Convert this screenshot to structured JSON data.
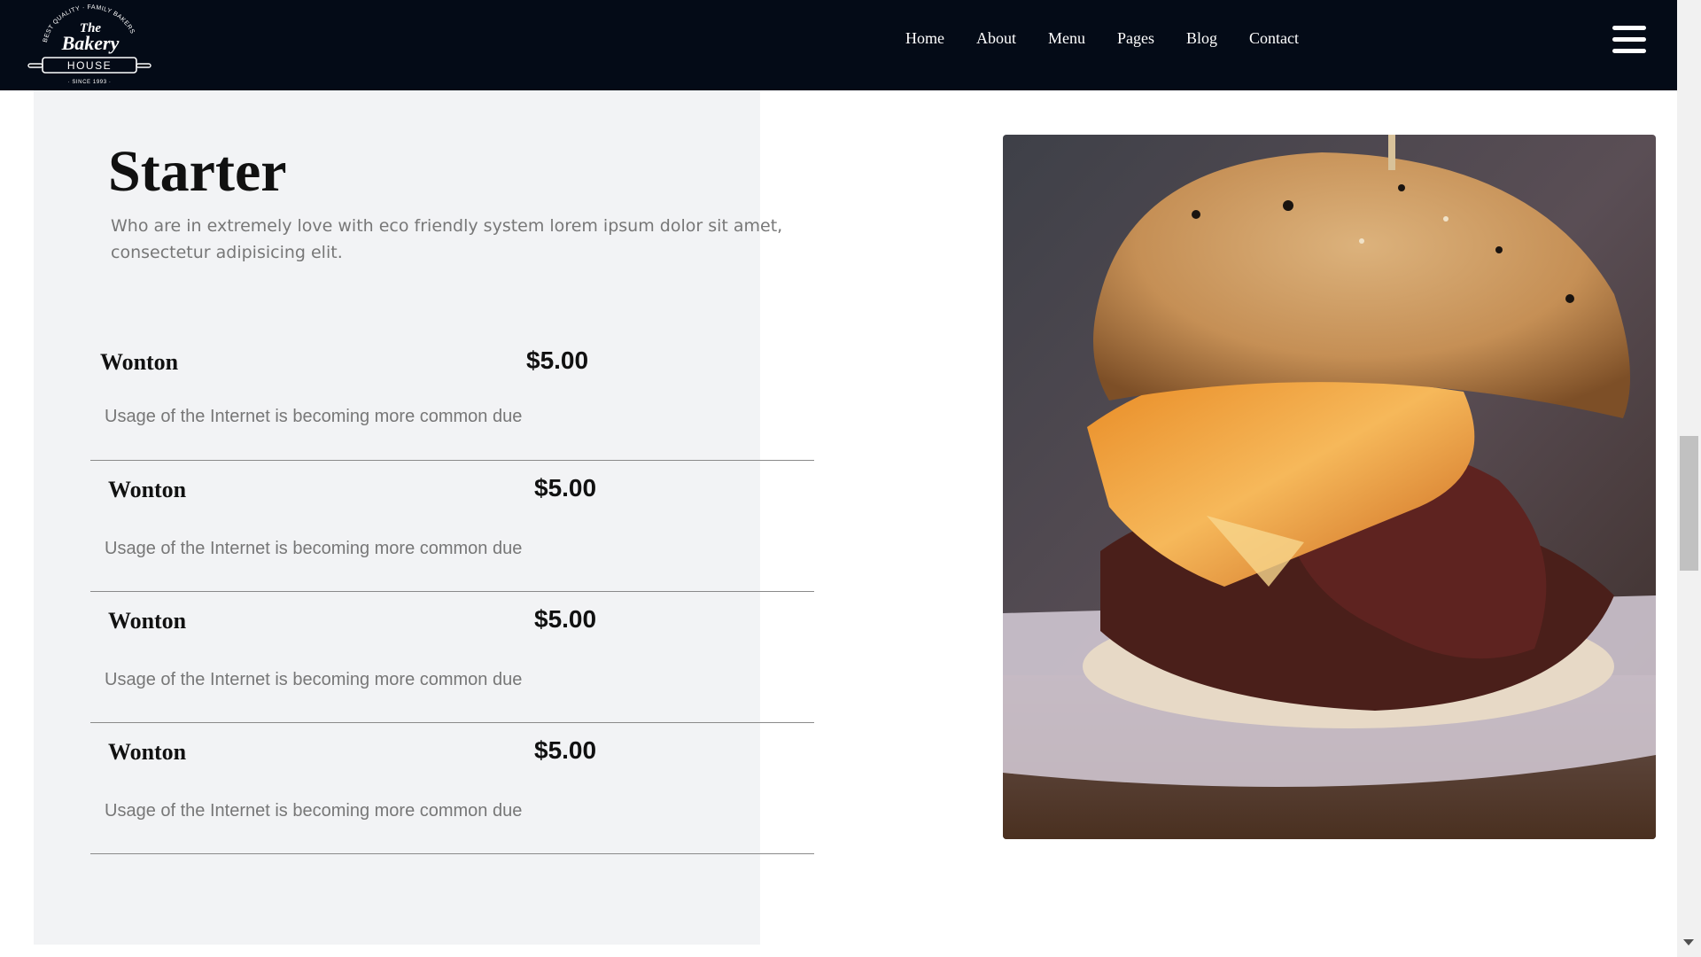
{
  "brand": {
    "logo_top": "BEST QUALITY · FAMILY BAKERS",
    "logo_the": "The",
    "logo_name": "Bakery",
    "logo_house": "HOUSE",
    "logo_since": "· SINCE 1993 ·"
  },
  "nav": {
    "items": [
      {
        "label": "Home"
      },
      {
        "label": "About"
      },
      {
        "label": "Menu"
      },
      {
        "label": "Pages"
      },
      {
        "label": "Blog"
      },
      {
        "label": "Contact"
      }
    ],
    "menu_icon": "hamburger-icon"
  },
  "section": {
    "title": "Starter",
    "description": "Who are in extremely love with eco friendly system lorem ipsum dolor sit amet, consectetur adipisicing elit."
  },
  "menu_items": [
    {
      "name": "Wonton",
      "price": "$5.00",
      "description": "Usage of the Internet is becoming more common due"
    },
    {
      "name": "Wonton",
      "price": "$5.00",
      "description": "Usage of the Internet is becoming more common due"
    },
    {
      "name": "Wonton",
      "price": "$5.00",
      "description": "Usage of the Internet is becoming more common due"
    },
    {
      "name": "Wonton",
      "price": "$5.00",
      "description": "Usage of the Internet is becoming more common due"
    }
  ],
  "image": {
    "subject": "burger"
  },
  "colors": {
    "header_bg": "#040b17",
    "panel_bg": "#f2f3f5",
    "text_dark": "#111111",
    "text_muted": "#777777"
  }
}
